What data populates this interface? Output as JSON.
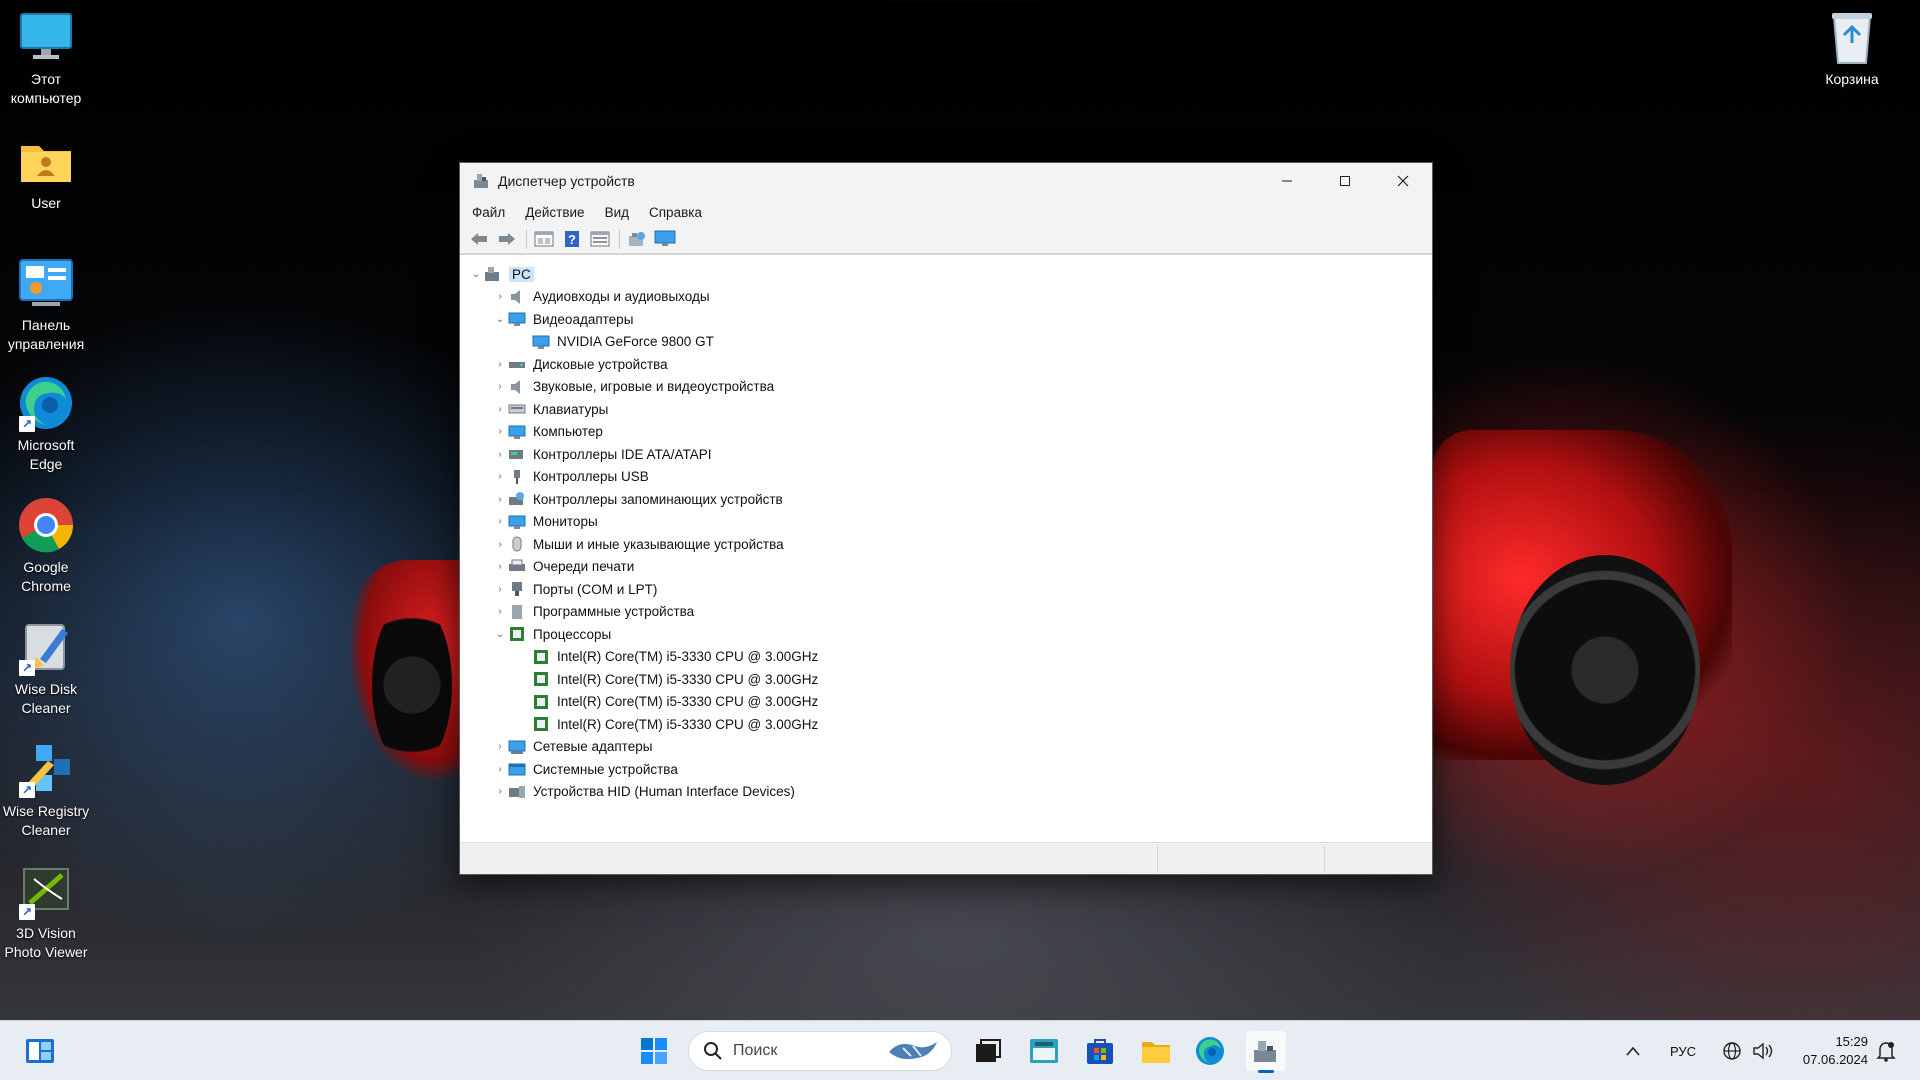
{
  "desktop": {
    "icons": [
      {
        "name": "this-pc",
        "label": "Этот компьютер"
      },
      {
        "name": "user-folder",
        "label": "User"
      },
      {
        "name": "control-panel",
        "label": "Панель управления"
      },
      {
        "name": "microsoft-edge",
        "label": "Microsoft Edge"
      },
      {
        "name": "google-chrome",
        "label": "Google Chrome"
      },
      {
        "name": "wise-disk-cleaner",
        "label": "Wise Disk Cleaner"
      },
      {
        "name": "wise-registry-cleaner",
        "label": "Wise Registry Cleaner"
      },
      {
        "name": "3d-vision-photo-viewer",
        "label": "3D Vision Photo Viewer"
      }
    ],
    "recycle_bin": {
      "label": "Корзина"
    }
  },
  "window": {
    "title": "Диспетчер устройств",
    "menu": [
      "Файл",
      "Действие",
      "Вид",
      "Справка"
    ],
    "toolbar_icons": [
      "back-arrow-icon",
      "forward-arrow-icon",
      "properties-icon",
      "help-icon",
      "view-icon",
      "scan-hardware-icon",
      "monitor-icon"
    ],
    "tree": {
      "root": "PC",
      "items": [
        {
          "label": "Аудиовходы и аудиовыходы",
          "icon": "speaker-icon",
          "expanded": false
        },
        {
          "label": "Видеоадаптеры",
          "icon": "display-adapter-icon",
          "expanded": true,
          "children": [
            "NVIDIA GeForce 9800 GT"
          ]
        },
        {
          "label": "Дисковые устройства",
          "icon": "disk-drive-icon",
          "expanded": false
        },
        {
          "label": "Звуковые, игровые и видеоустройства",
          "icon": "sound-icon",
          "expanded": false
        },
        {
          "label": "Клавиатуры",
          "icon": "keyboard-icon",
          "expanded": false
        },
        {
          "label": "Компьютер",
          "icon": "computer-icon",
          "expanded": false
        },
        {
          "label": "Контроллеры IDE ATA/ATAPI",
          "icon": "ide-controller-icon",
          "expanded": false
        },
        {
          "label": "Контроллеры USB",
          "icon": "usb-icon",
          "expanded": false
        },
        {
          "label": "Контроллеры запоминающих устройств",
          "icon": "storage-controller-icon",
          "expanded": false
        },
        {
          "label": "Мониторы",
          "icon": "monitor-icon",
          "expanded": false
        },
        {
          "label": "Мыши и иные указывающие устройства",
          "icon": "mouse-icon",
          "expanded": false
        },
        {
          "label": "Очереди печати",
          "icon": "printer-icon",
          "expanded": false
        },
        {
          "label": "Порты (COM и LPT)",
          "icon": "port-icon",
          "expanded": false
        },
        {
          "label": "Программные устройства",
          "icon": "software-device-icon",
          "expanded": false
        },
        {
          "label": "Процессоры",
          "icon": "processor-icon",
          "expanded": true,
          "children": [
            "Intel(R) Core(TM) i5-3330 CPU @ 3.00GHz",
            "Intel(R) Core(TM) i5-3330 CPU @ 3.00GHz",
            "Intel(R) Core(TM) i5-3330 CPU @ 3.00GHz",
            "Intel(R) Core(TM) i5-3330 CPU @ 3.00GHz"
          ]
        },
        {
          "label": "Сетевые адаптеры",
          "icon": "network-adapter-icon",
          "expanded": false
        },
        {
          "label": "Системные устройства",
          "icon": "system-devices-icon",
          "expanded": false
        },
        {
          "label": "Устройства HID (Human Interface Devices)",
          "icon": "hid-icon",
          "expanded": false
        }
      ]
    }
  },
  "taskbar": {
    "search_placeholder": "Поиск",
    "language": "РУС",
    "time": "15:29",
    "date": "07.06.2024"
  },
  "colors": {
    "accent": "#0067c0",
    "selection": "#cce4f7",
    "taskbar_bg": "#e8edf3"
  }
}
